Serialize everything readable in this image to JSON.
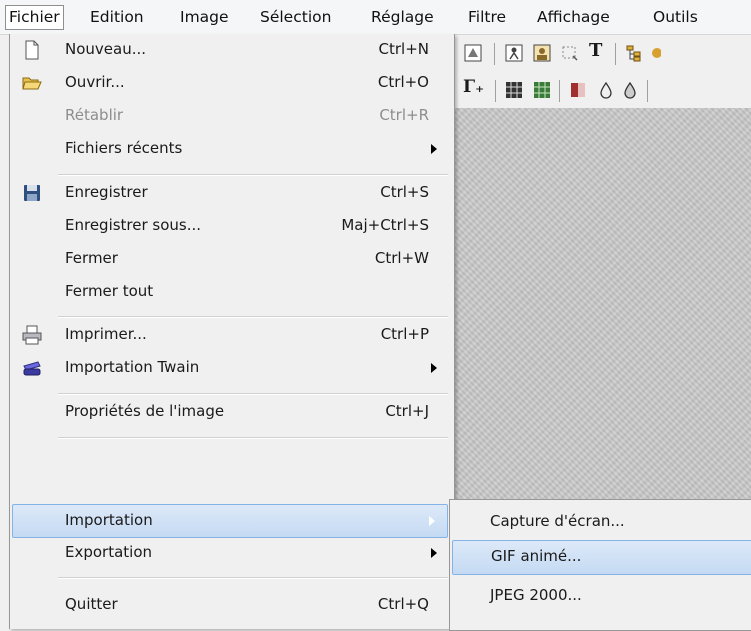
{
  "menubar": {
    "items": [
      "Fichier",
      "Edition",
      "Image",
      "Sélection",
      "Réglage",
      "Filtre",
      "Affichage",
      "Outils"
    ]
  },
  "menu": {
    "items": [
      {
        "label": "Nouveau...",
        "shortcut": "Ctrl+N",
        "icon": "new-file-icon"
      },
      {
        "label": "Ouvrir...",
        "shortcut": "Ctrl+O",
        "icon": "open-folder-icon"
      },
      {
        "label": "Rétablir",
        "shortcut": "Ctrl+R",
        "disabled": true
      },
      {
        "label": "Fichiers récents",
        "submenu": true
      },
      {
        "label": "Enregistrer",
        "shortcut": "Ctrl+S",
        "icon": "save-icon"
      },
      {
        "label": "Enregistrer sous...",
        "shortcut": "Maj+Ctrl+S"
      },
      {
        "label": "Fermer",
        "shortcut": "Ctrl+W"
      },
      {
        "label": "Fermer tout"
      },
      {
        "label": "Imprimer...",
        "shortcut": "Ctrl+P",
        "icon": "printer-icon"
      },
      {
        "label": "Importation Twain",
        "submenu": true,
        "icon": "scanner-icon"
      },
      {
        "label": "Propriétés de l'image",
        "shortcut": "Ctrl+J"
      },
      {
        "label": "Importation",
        "submenu": true,
        "highlighted": true
      },
      {
        "label": "Exportation",
        "submenu": true
      },
      {
        "label": "Quitter",
        "shortcut": "Ctrl+Q"
      }
    ]
  },
  "submenu": {
    "items": [
      {
        "label": "Capture d'écran..."
      },
      {
        "label": "GIF animé...",
        "highlighted": true
      },
      {
        "label": "JPEG 2000..."
      }
    ]
  },
  "toolbar": {
    "text_tool_glyph": "T",
    "gamma_glyph": "Γ₊"
  },
  "colors": {
    "highlight_top": "#dde9f8",
    "highlight_bottom": "#c4daf3",
    "highlight_border": "#86b3e6",
    "disabled_text": "#8d8d8d"
  }
}
